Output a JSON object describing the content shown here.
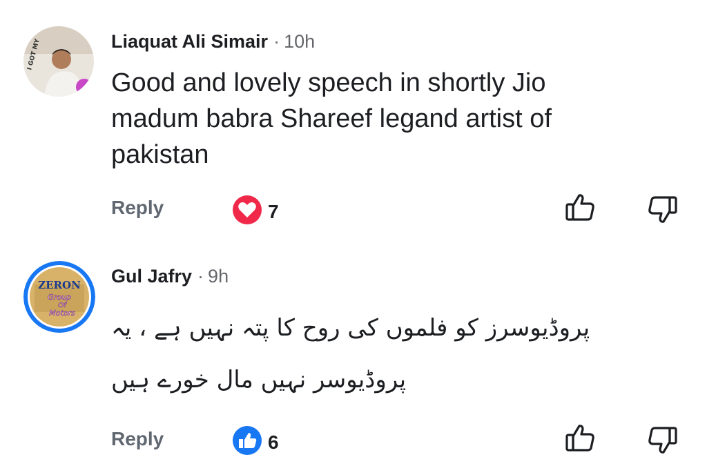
{
  "comments": [
    {
      "author": "Liaquat Ali Simair",
      "separator": "·",
      "time": "10h",
      "lines": [
        "Good and lovely speech in shortly Jio",
        "madum babra Shareef  legand artist of",
        "pakistan"
      ],
      "reply_label": "Reply",
      "reaction_icon": "heart-icon",
      "reaction_color": "#f02849",
      "reaction_count": "7",
      "avatar_text": "I GOT MY"
    },
    {
      "author": "Gul Jafry",
      "separator": "·",
      "time": "9h",
      "lines": [
        "پروڈیوسرز کو فلموں کی روح کا پتہ نہیں ہے ، یہ",
        "پروڈیوسر نہیں مال خورے ہیں"
      ],
      "reply_label": "Reply",
      "reaction_icon": "like-icon",
      "reaction_color": "#1877f2",
      "reaction_count": "6",
      "avatar_text": [
        "ZERON",
        "Group",
        "Of",
        "Motors"
      ]
    }
  ]
}
